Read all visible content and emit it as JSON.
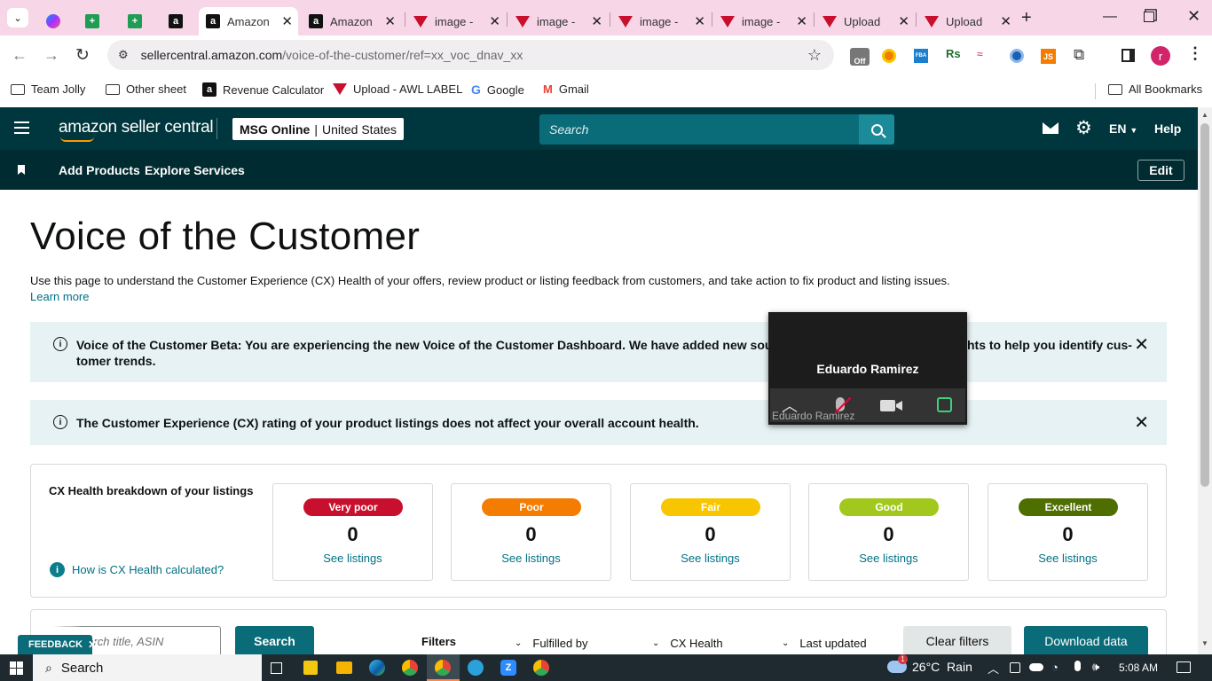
{
  "browser": {
    "tabs": [
      {
        "title": "",
        "icon": "messenger-icon"
      },
      {
        "title": "",
        "icon": "sheets-icon"
      },
      {
        "title": "",
        "icon": "sheets-icon"
      },
      {
        "title": "",
        "icon": "amazon-icon"
      },
      {
        "title": "Amazon",
        "icon": "amazon-icon",
        "active": true
      },
      {
        "title": "Amazon",
        "icon": "amazon-icon"
      },
      {
        "title": "image -",
        "icon": "triangle-logo-icon"
      },
      {
        "title": "image -",
        "icon": "triangle-logo-icon"
      },
      {
        "title": "image -",
        "icon": "triangle-logo-icon"
      },
      {
        "title": "image -",
        "icon": "triangle-logo-icon"
      },
      {
        "title": "Upload",
        "icon": "triangle-logo-icon"
      },
      {
        "title": "Upload",
        "icon": "triangle-logo-icon"
      }
    ],
    "url_host": "sellercentral.amazon.com",
    "url_path": "/voice-of-the-customer/ref=xx_voc_dnav_xx",
    "bookmarks": [
      "Team Jolly",
      "Other sheet",
      "Revenue Calculator",
      "Upload - AWL LABEL",
      "Google",
      "Gmail"
    ],
    "all_bookmarks": "All Bookmarks",
    "profile_initial": "r",
    "ext_badge": "Off"
  },
  "header": {
    "logo": "amazon seller central",
    "store_name": "MSG Online",
    "store_region": "United States",
    "search_placeholder": "Search",
    "language": "EN",
    "help": "Help"
  },
  "nav": {
    "items": [
      "Add Products",
      "Explore Services"
    ],
    "edit": "Edit"
  },
  "page": {
    "title": "Voice of the Customer",
    "intro": "Use this page to understand the Customer Experience (CX) Health of your offers, review product or listing feedback from customers, and take action to fix product and listing issues.",
    "learn_more": "Learn more",
    "alert1_a": "Voice of the Customer Beta: You are experiencing the new Voice of the Customer Dashboard. We have added new sourc",
    "alert1_b": "hts to help you identify cus-",
    "alert1_c": "tomer trends.",
    "alert2": "The Customer Experience (CX) rating of your product listings does not affect your overall account health."
  },
  "cx": {
    "heading": "CX Health breakdown of your listings",
    "how_link": "How is CX Health calculated?",
    "see_listings": "See listings",
    "cards": [
      {
        "label": "Very poor",
        "count": "0",
        "color": "#c8102e",
        "text": "#ffffff"
      },
      {
        "label": "Poor",
        "count": "0",
        "color": "#f47c00",
        "text": "#ffffff"
      },
      {
        "label": "Fair",
        "count": "0",
        "color": "#f7c600",
        "text": "#ffffff"
      },
      {
        "label": "Good",
        "count": "0",
        "color": "#a2c81e",
        "text": "#ffffff"
      },
      {
        "label": "Excellent",
        "count": "0",
        "color": "#4e6e00",
        "text": "#ffffff"
      }
    ]
  },
  "filters": {
    "search_placeholder": "earch title, ASIN",
    "search_button": "Search",
    "label": "Filters",
    "fulfilled_by": "Fulfilled by",
    "cx_health": "CX Health",
    "last_updated": "Last updated",
    "clear": "Clear filters",
    "download": "Download data"
  },
  "video": {
    "name": "Eduardo Ramirez",
    "name_overlay": "Eduardo Ramirez"
  },
  "feedback": "FEEDBACK",
  "taskbar": {
    "search": "Search",
    "weather": "26°C  Rain",
    "time": "5:08 AM",
    "weather_badge": "1"
  }
}
